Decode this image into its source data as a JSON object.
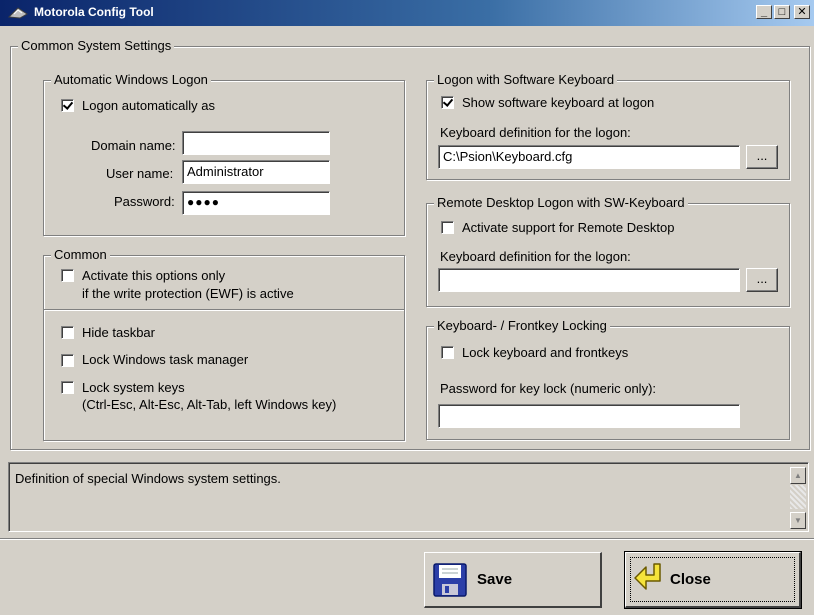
{
  "window": {
    "title": "Motorola Config Tool",
    "minimize_label": "_",
    "maximize_label": "□",
    "close_label": "✕"
  },
  "main_group": {
    "title": "Common System Settings"
  },
  "auto_logon": {
    "title": "Automatic Windows Logon",
    "logon_auto_label": "Logon automatically as",
    "logon_auto_checked": true,
    "domain_label": "Domain name:",
    "domain_value": "",
    "user_label": "User name:",
    "user_value": "Administrator",
    "password_label": "Password:",
    "password_value": "●●●●"
  },
  "common": {
    "title": "Common",
    "ewf_label_line1": "Activate this options only",
    "ewf_label_line2": "if the write protection (EWF) is active",
    "ewf_checked": false,
    "hide_taskbar_label": "Hide taskbar",
    "hide_taskbar_checked": false,
    "lock_task_manager_label": "Lock Windows task manager",
    "lock_task_manager_checked": false,
    "lock_system_keys_label": "Lock system keys",
    "lock_system_keys_detail": "(Ctrl-Esc, Alt-Esc, Alt-Tab, left Windows key)",
    "lock_system_keys_checked": false
  },
  "sw_keyboard": {
    "title": "Logon with Software Keyboard",
    "show_label": "Show software keyboard at logon",
    "show_checked": true,
    "def_label": "Keyboard definition for the logon:",
    "def_value": "C:\\Psion\\Keyboard.cfg",
    "browse_label": "..."
  },
  "remote_desktop": {
    "title": "Remote Desktop Logon with SW-Keyboard",
    "activate_label": "Activate support for Remote Desktop",
    "activate_checked": false,
    "def_label": "Keyboard definition for the logon:",
    "def_value": "",
    "browse_label": "..."
  },
  "key_locking": {
    "title": "Keyboard- / Frontkey Locking",
    "lock_label": "Lock keyboard and frontkeys",
    "lock_checked": false,
    "password_label": "Password for key lock (numeric only):",
    "password_value": ""
  },
  "status": {
    "text": "Definition of special Windows system settings.",
    "scroll_up": "▲",
    "scroll_down": "▼"
  },
  "buttons": {
    "save_label": "Save",
    "close_label": "Close"
  },
  "icons": {
    "app": "motorola-icon",
    "save": "floppy-disk-icon",
    "close": "yellow-arrow-icon"
  }
}
